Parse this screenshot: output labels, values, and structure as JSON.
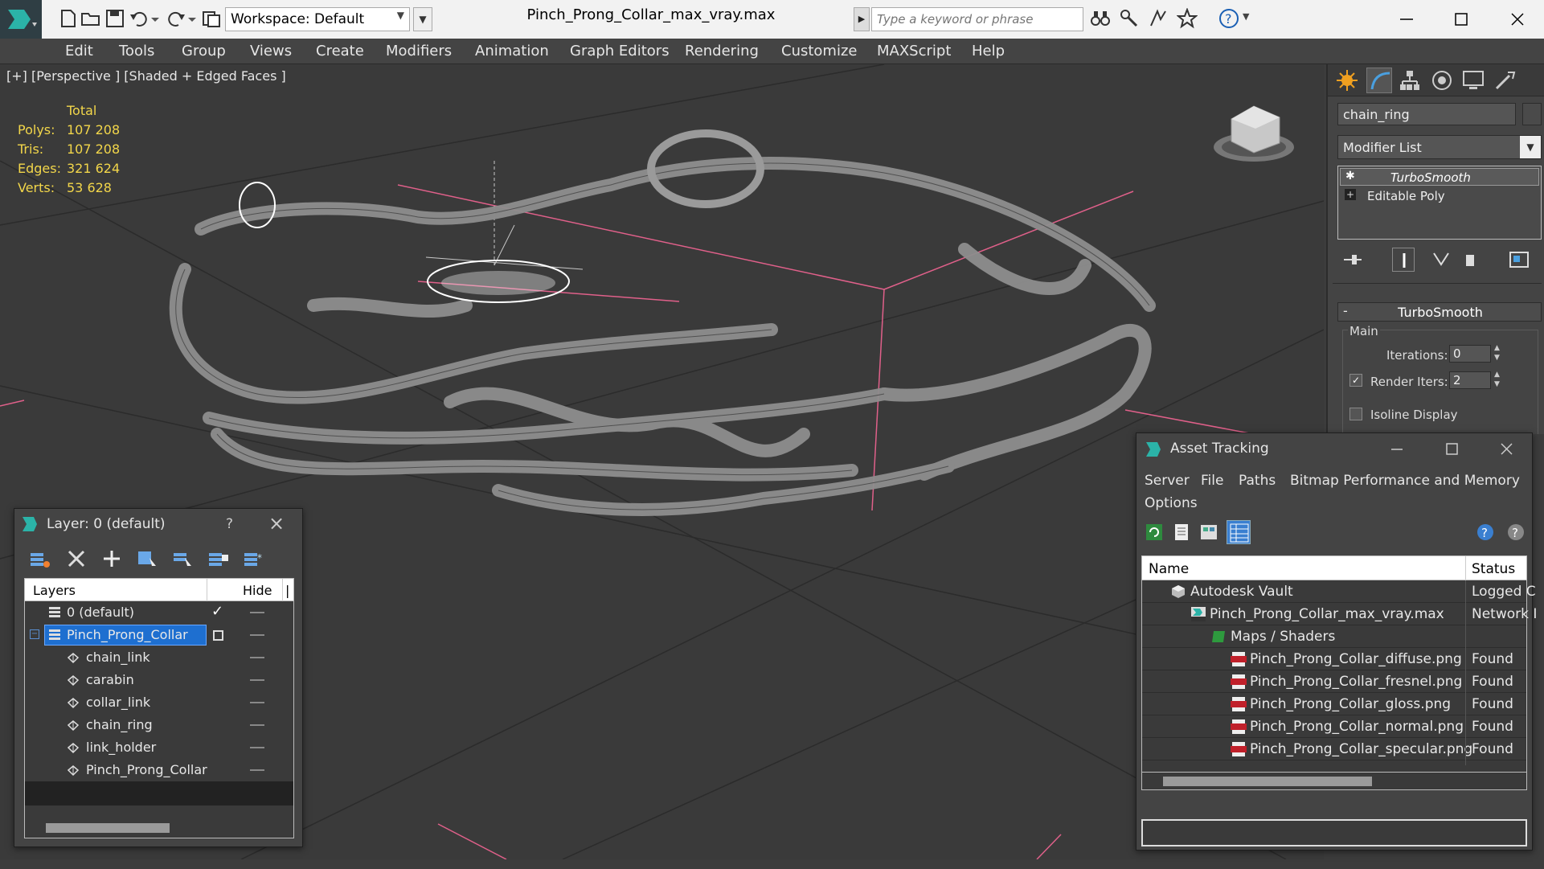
{
  "titlebar": {
    "workspace_label": "Workspace: Default",
    "file_title": "Pinch_Prong_Collar_max_vray.max",
    "search_placeholder": "Type a keyword or phrase"
  },
  "menu": [
    "Edit",
    "Tools",
    "Group",
    "Views",
    "Create",
    "Modifiers",
    "Animation",
    "Graph Editors",
    "Rendering",
    "Customize",
    "MAXScript",
    "Help"
  ],
  "viewport": {
    "label": "[+] [Perspective ] [Shaded + Edged Faces ]",
    "stats": {
      "header": "Total",
      "rows": [
        {
          "label": "Polys:",
          "value": "107 208"
        },
        {
          "label": "Tris:",
          "value": "107 208"
        },
        {
          "label": "Edges:",
          "value": "321 624"
        },
        {
          "label": "Verts:",
          "value": "53 628"
        }
      ]
    }
  },
  "cmdpanel": {
    "object_name": "chain_ring",
    "modifier_list": "Modifier List",
    "stack": [
      "TurboSmooth",
      "Editable Poly"
    ],
    "rollout_title": "TurboSmooth",
    "group_main": "Main",
    "iterations_label": "Iterations:",
    "iterations_value": "0",
    "render_iters_label": "Render Iters:",
    "render_iters_value": "2",
    "render_iters_checked": true,
    "isoline_label": "Isoline Display"
  },
  "layer_window": {
    "title": "Layer: 0 (default)",
    "help": "?",
    "col_layers": "Layers",
    "col_hide": "Hide",
    "rows": [
      {
        "name": "0 (default)",
        "kind": "layer",
        "selected": false,
        "current": true
      },
      {
        "name": "Pinch_Prong_Collar",
        "kind": "layer",
        "selected": true,
        "current": false
      },
      {
        "name": "chain_link",
        "kind": "object",
        "selected": false,
        "current": false
      },
      {
        "name": "carabin",
        "kind": "object",
        "selected": false,
        "current": false
      },
      {
        "name": "collar_link",
        "kind": "object",
        "selected": false,
        "current": false
      },
      {
        "name": "chain_ring",
        "kind": "object",
        "selected": false,
        "current": false
      },
      {
        "name": "link_holder",
        "kind": "object",
        "selected": false,
        "current": false
      },
      {
        "name": "Pinch_Prong_Collar",
        "kind": "object",
        "selected": false,
        "current": false
      }
    ]
  },
  "asset_window": {
    "title": "Asset Tracking",
    "menu": [
      "Server",
      "File",
      "Paths",
      "Bitmap Performance and Memory",
      "Options"
    ],
    "col_name": "Name",
    "col_status": "Status",
    "rows": [
      {
        "name": "Autodesk Vault",
        "status": "Logged C",
        "icon": "vault-icon"
      },
      {
        "name": "Pinch_Prong_Collar_max_vray.max",
        "status": "Network I",
        "icon": "max-file-icon"
      },
      {
        "name": "Maps / Shaders",
        "status": "",
        "icon": "maps-folder-icon"
      },
      {
        "name": "Pinch_Prong_Collar_diffuse.png",
        "status": "Found",
        "icon": "png-file-icon"
      },
      {
        "name": "Pinch_Prong_Collar_fresnel.png",
        "status": "Found",
        "icon": "png-file-icon"
      },
      {
        "name": "Pinch_Prong_Collar_gloss.png",
        "status": "Found",
        "icon": "png-file-icon"
      },
      {
        "name": "Pinch_Prong_Collar_normal.png",
        "status": "Found",
        "icon": "png-file-icon"
      },
      {
        "name": "Pinch_Prong_Collar_specular.png",
        "status": "Found",
        "icon": "png-file-icon"
      }
    ]
  },
  "colors": {
    "stats_yellow": "#f2d64a",
    "selection_blue": "#1e6fd0",
    "grid_pink": "#e0608a",
    "wire_gray": "#b0b0b0"
  }
}
